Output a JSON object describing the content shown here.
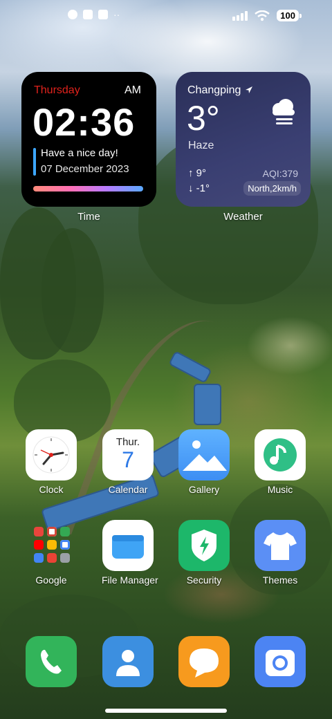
{
  "status_bar": {
    "battery": "100"
  },
  "time_widget": {
    "day": "Thursday",
    "ampm": "AM",
    "time": "02:36",
    "message": "Have a nice day!",
    "date": "07 December 2023",
    "label": "Time"
  },
  "weather_widget": {
    "city": "Changping",
    "temperature": "3°",
    "condition": "Haze",
    "high": "9°",
    "low": "-1°",
    "aqi": "AQI:379",
    "wind": "North,2km/h",
    "label": "Weather"
  },
  "apps": {
    "clock": "Clock",
    "calendar": "Calendar",
    "calendar_day": "Thur.",
    "calendar_date": "7",
    "gallery": "Gallery",
    "music": "Music",
    "google": "Google",
    "file_manager": "File Manager",
    "security": "Security",
    "themes": "Themes"
  },
  "dock": [
    "phone-icon",
    "contacts-icon",
    "messages-icon",
    "camera-icon"
  ],
  "colors": {
    "accent_red": "#e0221c",
    "weather_bg": "#2a2f58",
    "security_green": "#1db76a",
    "gallery_blue": "#4aa3ff",
    "themes_blue": "#5b8ff5",
    "messages_orange": "#f79a1e",
    "contacts_blue": "#3c8fe0",
    "phone_green": "#32b45a"
  }
}
